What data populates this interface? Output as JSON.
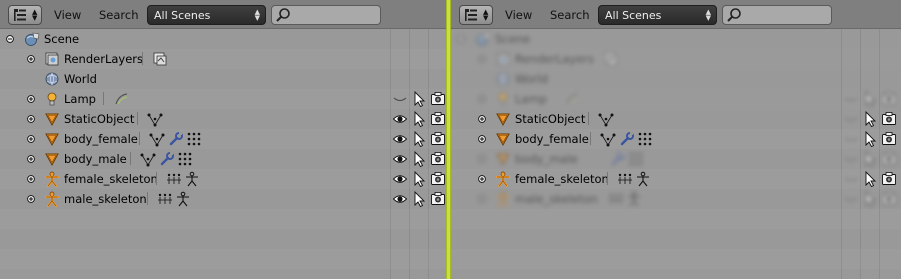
{
  "header": {
    "view_label": "View",
    "search_label": "Search",
    "scene_select": "All Scenes",
    "search_value": ""
  },
  "tree": {
    "scene": "Scene",
    "items": [
      {
        "label": "RenderLayers"
      },
      {
        "label": "World"
      },
      {
        "label": "Lamp"
      },
      {
        "label": "StaticObject"
      },
      {
        "label": "body_female"
      },
      {
        "label": "body_male"
      },
      {
        "label": "female_skeleton"
      },
      {
        "label": "male_skeleton"
      }
    ]
  },
  "colors": {
    "divider": "#c9e040",
    "background": "#999999",
    "header": "#7f7f7f",
    "select": "#333333"
  }
}
